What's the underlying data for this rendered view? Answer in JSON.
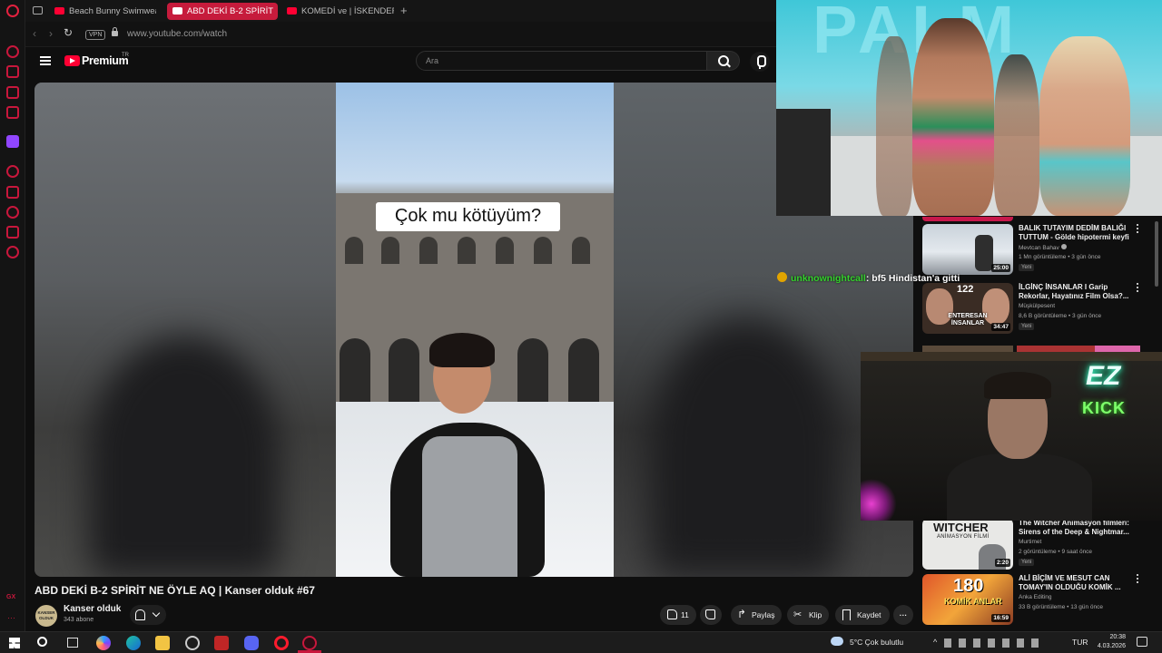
{
  "browser": {
    "tabs": [
      {
        "label": "Beach Bunny Swimwear F"
      },
      {
        "label": "ABD DEKİ B-2 SPİRİT"
      },
      {
        "label": "KOMEDİ ve | İSKENDER - "
      }
    ],
    "vpn_label": "VPN",
    "url": "www.youtube.com/watch"
  },
  "youtube": {
    "brand": "Premium",
    "brand_sup": "TR",
    "search_placeholder": "Ara"
  },
  "video": {
    "caption": "Çok mu kötüyüm?",
    "title": "ABD DEKİ B-2 SPİRİT NE ÖYLE AQ | Kanser olduk #67",
    "channel": "Kanser olduk",
    "channel_avatar_text": "KANSER OLDUK",
    "subscribers": "343 abone",
    "likes": "11",
    "share_label": "Paylaş",
    "clip_label": "Klip",
    "save_label": "Kaydet"
  },
  "recommendations": [
    {
      "title": "BALIK TUTAYIM DEDİM BALIĞI TUTTUM - Gölde hipotermi keyfi",
      "channel": "Mevtcan Bahav",
      "verified": true,
      "views": "1 Mn görüntüleme • 3 gün önce",
      "badge": "Yeni",
      "duration": "25:00"
    },
    {
      "title": "İLGİNÇ İNSANLAR I Garip Rekorlar, Hayatınız Film Olsa?...",
      "channel": "Müşkülpesent",
      "views": "8,6 B görüntüleme • 3 gün önce",
      "badge": "Yeni",
      "duration": "34:47",
      "thumb_text": "ENTERESAN İNSANLAR",
      "thumb_num": "122"
    },
    {
      "title": "The Witcher Animasyon filmleri: Sirens of the Deep & Nightmar...",
      "channel": "Murtimet",
      "views": "2 görüntüleme • 9 saat önce",
      "badge": "Yeni",
      "duration": "2:20",
      "thumb_text": "WITCHER",
      "thumb_sub": "ANİMASYON FİLMİ"
    },
    {
      "title": "ALİ BİÇİM VE MESUT CAN TOMAY'IN OLDUĞU KOMİK ...",
      "channel": "Anka Editing",
      "views": "33 B görüntüleme • 13 gün önce",
      "duration": "16:59",
      "thumb_text": "180",
      "thumb_sub": "KOMİK ANLAR"
    }
  ],
  "chat": {
    "user": "unknownightcall",
    "message": ": bf5 Hindistan'a gitti"
  },
  "webcam": {
    "neon_top": "EZ",
    "neon_bottom": "KICK"
  },
  "taskbar": {
    "weather": "5°C  Çok bulutlu",
    "language": "TUR",
    "time": "20:38",
    "date": "4.03.2026"
  },
  "colors": {
    "opera_red": "#c61b3c",
    "yt_red": "#ff0033",
    "chat_user": "#35d22d"
  }
}
